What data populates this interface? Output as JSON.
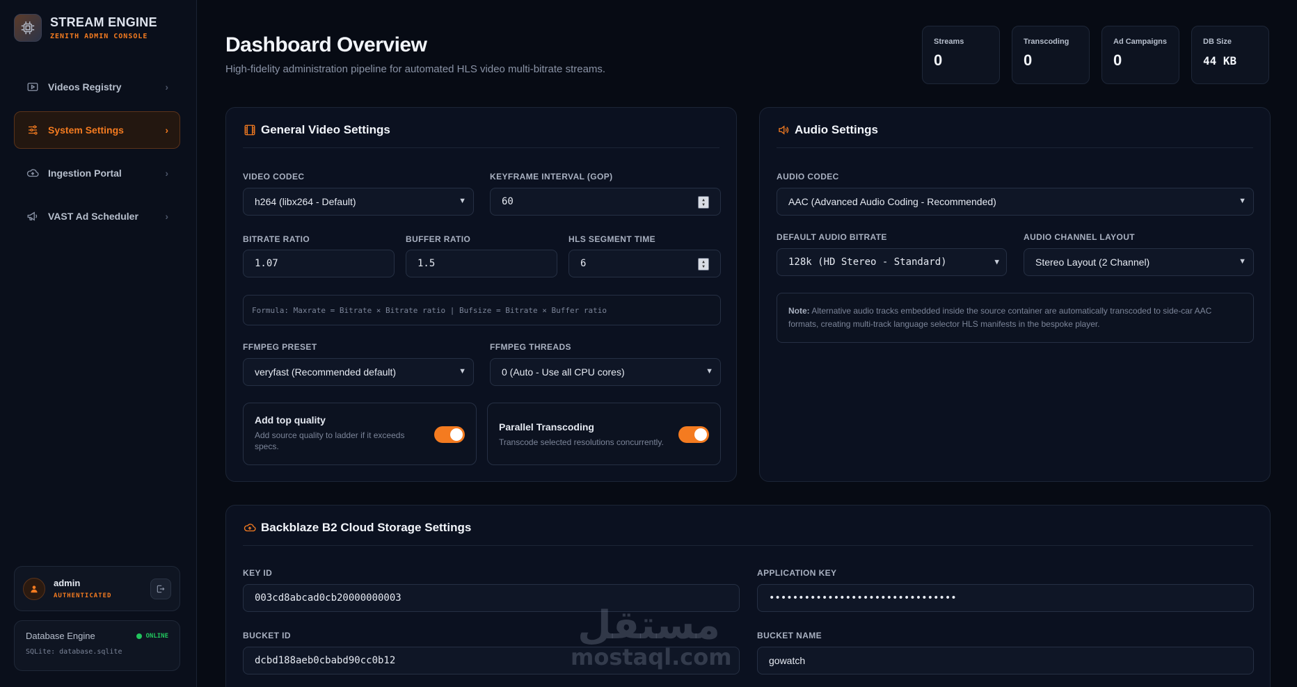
{
  "brand": {
    "title": "STREAM ENGINE",
    "subtitle": "ZENITH ADMIN CONSOLE"
  },
  "sidebar": {
    "items": [
      {
        "label": "Videos Registry",
        "icon": "video-icon",
        "active": false
      },
      {
        "label": "System Settings",
        "icon": "sliders-icon",
        "active": true
      },
      {
        "label": "Ingestion Portal",
        "icon": "cloud-upload-icon",
        "active": false
      },
      {
        "label": "VAST Ad Scheduler",
        "icon": "megaphone-icon",
        "active": false
      }
    ]
  },
  "user": {
    "name": "admin",
    "status": "AUTHENTICATED"
  },
  "database": {
    "title": "Database Engine",
    "status": "ONLINE",
    "path": "SQLite: database.sqlite"
  },
  "header": {
    "title": "Dashboard Overview",
    "subtitle": "High-fidelity administration pipeline for automated HLS video multi-bitrate streams."
  },
  "stats": [
    {
      "label": "Streams",
      "value": "0"
    },
    {
      "label": "Transcoding",
      "value": "0"
    },
    {
      "label": "Ad Campaigns",
      "value": "0"
    },
    {
      "label": "DB Size",
      "value": "44 KB"
    }
  ],
  "video": {
    "title": "General Video Settings",
    "codec_label": "VIDEO CODEC",
    "codec_value": "h264 (libx264 - Default)",
    "gop_label": "KEYFRAME INTERVAL (GOP)",
    "gop_value": "60",
    "bitrate_label": "BITRATE RATIO",
    "bitrate_value": "1.07",
    "buffer_label": "BUFFER RATIO",
    "buffer_value": "1.5",
    "segment_label": "HLS SEGMENT TIME",
    "segment_value": "6",
    "formula": "Formula: Maxrate = Bitrate × Bitrate ratio | Bufsize = Bitrate × Buffer ratio",
    "preset_label": "FFMPEG PRESET",
    "preset_value": "veryfast (Recommended default)",
    "threads_label": "FFMPEG THREADS",
    "threads_value": "0 (Auto - Use all CPU cores)",
    "toggle1_title": "Add top quality",
    "toggle1_desc": "Add source quality to ladder if it exceeds specs.",
    "toggle1_on": true,
    "toggle2_title": "Parallel Transcoding",
    "toggle2_desc": "Transcode selected resolutions concurrently.",
    "toggle2_on": true
  },
  "audio": {
    "title": "Audio Settings",
    "codec_label": "AUDIO CODEC",
    "codec_value": "AAC (Advanced Audio Coding - Recommended)",
    "bitrate_label": "DEFAULT AUDIO BITRATE",
    "bitrate_value": "128k (HD Stereo - Standard)",
    "layout_label": "AUDIO CHANNEL LAYOUT",
    "layout_value": "Stereo Layout (2 Channel)",
    "note_label": "Note:",
    "note_text": "Alternative audio tracks embedded inside the source container are automatically transcoded to side-car AAC formats, creating multi-track language selector HLS manifests in the bespoke player."
  },
  "storage": {
    "title": "Backblaze B2 Cloud Storage Settings",
    "key_id_label": "KEY ID",
    "key_id_value": "003cd8abcad0cb20000000003",
    "app_key_label": "APPLICATION KEY",
    "app_key_value": "••••••••••••••••••••••••••••••••",
    "bucket_id_label": "BUCKET ID",
    "bucket_id_value": "dcbd188aeb0cbabd90cc0b12",
    "bucket_name_label": "BUCKET NAME",
    "bucket_name_value": "gowatch"
  },
  "watermark": {
    "arabic": "مستقل",
    "latin": "mostaql.com"
  },
  "colors": {
    "accent": "#f47b20",
    "online": "#22c55e",
    "background": "#070b14"
  }
}
